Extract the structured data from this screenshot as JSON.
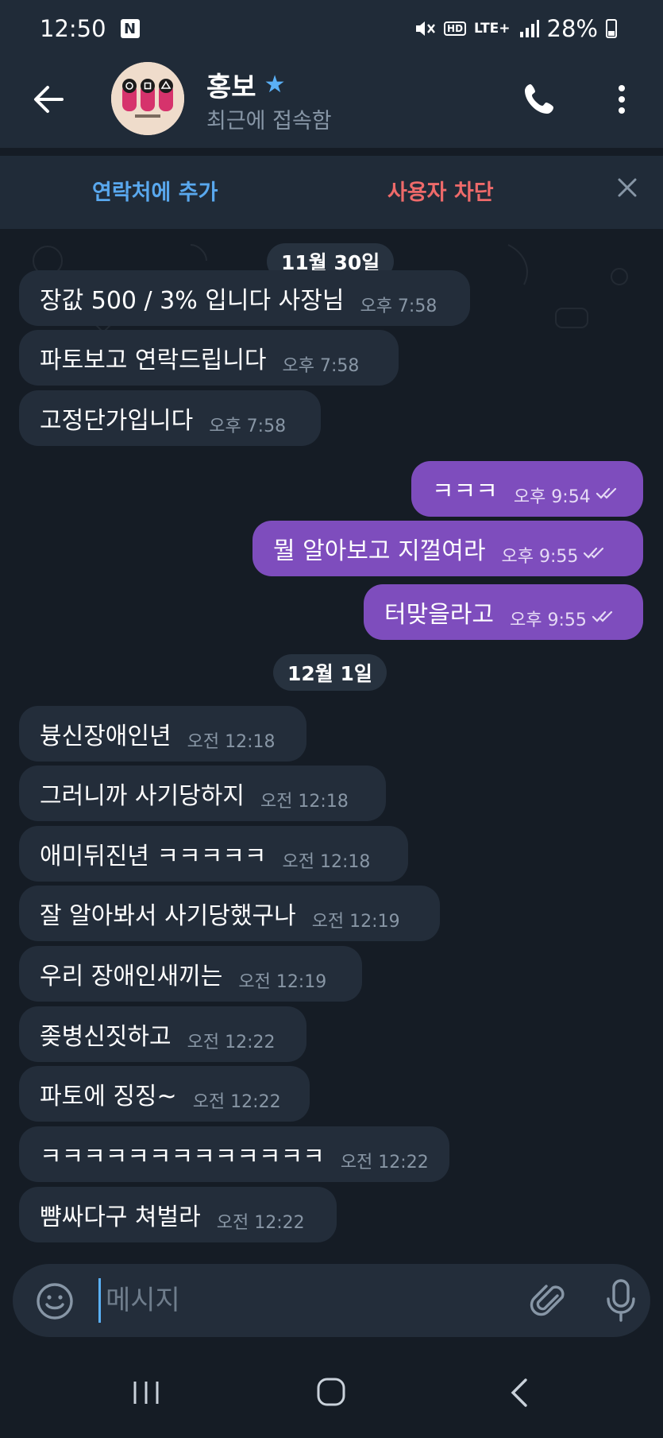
{
  "statusbar": {
    "time": "12:50",
    "notification_badge": "N",
    "hd": "HD",
    "network": "LTE+",
    "battery": "28%"
  },
  "header": {
    "contact_name": "홍보",
    "contact_status": "최근에 접속함",
    "icons": [
      "back-arrow-icon",
      "star-icon",
      "phone-icon",
      "more-vertical-icon"
    ]
  },
  "actionbar": {
    "add_contact": "연락처에 추가",
    "block_user": "사용자 차단"
  },
  "chat": {
    "dates": [
      "11월 30일",
      "12월 1일"
    ],
    "messages": [
      {
        "direction": "in",
        "text": "장값 500 / 3% 입니다 사장님",
        "time": "오후 7:58"
      },
      {
        "direction": "in",
        "text": "파토보고 연락드립니다",
        "time": "오후 7:58"
      },
      {
        "direction": "in",
        "text": "고정단가입니다",
        "time": "오후 7:58"
      },
      {
        "direction": "out",
        "text": "ㅋㅋㅋ",
        "time": "오후 9:54",
        "read": true
      },
      {
        "direction": "out",
        "text": "뭘 알아보고 지껄여라",
        "time": "오후 9:55",
        "read": true
      },
      {
        "direction": "out",
        "text": "터맞을라고",
        "time": "오후 9:55",
        "read": true
      },
      {
        "direction": "in",
        "text": "븅신장애인년",
        "time": "오전 12:18"
      },
      {
        "direction": "in",
        "text": "그러니까 사기당하지",
        "time": "오전 12:18"
      },
      {
        "direction": "in",
        "text": "애미뒤진년 ㅋㅋㅋㅋㅋ",
        "time": "오전 12:18"
      },
      {
        "direction": "in",
        "text": "잘 알아봐서 사기당했구나",
        "time": "오전 12:19"
      },
      {
        "direction": "in",
        "text": "우리 장애인새끼는",
        "time": "오전 12:19"
      },
      {
        "direction": "in",
        "text": "좆병신짓하고",
        "time": "오전 12:22"
      },
      {
        "direction": "in",
        "text": "파토에 징징~",
        "time": "오전 12:22"
      },
      {
        "direction": "in",
        "text": "ㅋㅋㅋㅋㅋㅋㅋㅋㅋㅋㅋㅋㅋ",
        "time": "오전 12:22"
      },
      {
        "direction": "in",
        "text": "뺨싸다구 쳐벌라",
        "time": "오전 12:22"
      }
    ]
  },
  "composer": {
    "placeholder": "메시지",
    "value": ""
  },
  "colors": {
    "bar_background": "#202b38",
    "chat_background": "#151c25",
    "incoming_bubble": "#232d3a",
    "outgoing_bubble": "#7e4dbd",
    "accent_blue": "#59a8ee",
    "danger_red": "#ee6a6a"
  }
}
